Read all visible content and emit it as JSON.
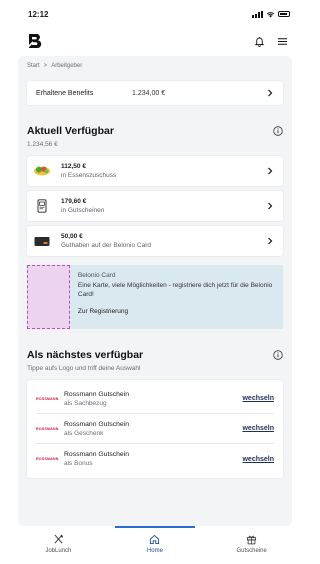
{
  "status_bar": {
    "time": "12:12"
  },
  "breadcrumb": {
    "home": "Start",
    "separator": ">",
    "current": "Arbeitgeber"
  },
  "benefits": {
    "label": "Erhaltene Benefits",
    "value": "1.234,00 €"
  },
  "available": {
    "title": "Aktuell Verfügbar",
    "total": "1.234,56 €",
    "items": [
      {
        "icon": "salad-bowl-icon",
        "amount": "112,50 €",
        "description": "in Essenszuschuss"
      },
      {
        "icon": "voucher-phone-icon",
        "amount": "179,60 €",
        "description": "in Gutscheinen"
      },
      {
        "icon": "card-icon",
        "amount": "50,00 €",
        "description": "Guthaben auf der Belonio Card"
      }
    ]
  },
  "promo": {
    "title": "Belonio Card",
    "body": "Eine Karte, viele Möglichkeiten - registriere dich jetzt für die Belonio Card!",
    "link": "Zur Registrierung"
  },
  "next": {
    "title": "Als nächstes verfügbar",
    "subtitle": "Tippe aufs Logo und triff deine Auswahl",
    "items": [
      {
        "logo": "ROSSMANN",
        "name": "Rossmann Gutschein",
        "kind": "als Sachbezug",
        "action": "wechseln"
      },
      {
        "logo": "ROSSMANN",
        "name": "Rossmann Gutschein",
        "kind": "als Geschenk",
        "action": "wechseln"
      },
      {
        "logo": "ROSSMANN",
        "name": "Rossmann Gutschein",
        "kind": "als Bonus",
        "action": "wechseln"
      }
    ]
  },
  "tabbar": {
    "items": [
      {
        "icon": "fork-knife-icon",
        "label": "JobLunch",
        "active": false
      },
      {
        "icon": "home-icon",
        "label": "Home",
        "active": true
      },
      {
        "icon": "gift-icon",
        "label": "Gutscheine",
        "active": false
      }
    ]
  },
  "colors": {
    "accent": "#2a6cd1",
    "background": "#f2f4f6",
    "promo": "#d9e9ef",
    "brand_red": "#d3123a",
    "link": "#1f2f57"
  }
}
